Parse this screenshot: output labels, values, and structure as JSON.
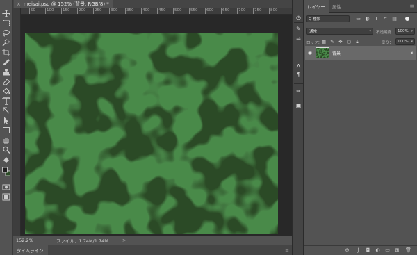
{
  "document": {
    "tab_title": "meisai.psd @ 152% (背景, RGB/8) *",
    "close_glyph": "×"
  },
  "ruler": {
    "ticks": [
      "50",
      "100",
      "150",
      "200",
      "250",
      "300",
      "350",
      "400",
      "450",
      "500",
      "550",
      "600",
      "650",
      "700",
      "750",
      "800"
    ]
  },
  "status_bar": {
    "zoom": "152.2%",
    "file_info": "ファイル：1.74M/1.74M",
    "arrow": ">"
  },
  "timeline": {
    "label": "タイムライン",
    "menu_glyph": "≡"
  },
  "layers_panel": {
    "tabs": [
      {
        "label": "レイヤー",
        "active": true
      },
      {
        "label": "属性",
        "active": false
      }
    ],
    "menu_glyph": "≡",
    "search_value": "Q 種類",
    "blend_mode": "通常",
    "opacity_label": "不透明度：",
    "opacity_value": "100%",
    "lock_label": "ロック：",
    "fill_label": "塗り：",
    "fill_value": "100%",
    "layers": [
      {
        "name": "背景",
        "visible": true,
        "locked": true
      }
    ]
  },
  "colors": {
    "camo_dark": "#2b4a26",
    "camo_light": "#4a8a4a",
    "accent_selected_row": "#696969"
  },
  "icons": {
    "toolbar": [
      "move-icon",
      "marquee-icon",
      "lasso-icon",
      "quick-select-icon",
      "crop-icon",
      "eyedropper-icon",
      "healing-brush-icon",
      "brush-icon",
      "clone-stamp-icon",
      "history-brush-icon",
      "eraser-icon",
      "gradient-icon",
      "blur-icon",
      "dodge-icon",
      "pen-icon",
      "type-icon",
      "path-select-icon",
      "rectangle-icon",
      "hand-icon",
      "zoom-icon",
      "paint-bucket-icon",
      "color-swatches-icon",
      "quick-mask-icon",
      "screen-mode-icon"
    ]
  }
}
